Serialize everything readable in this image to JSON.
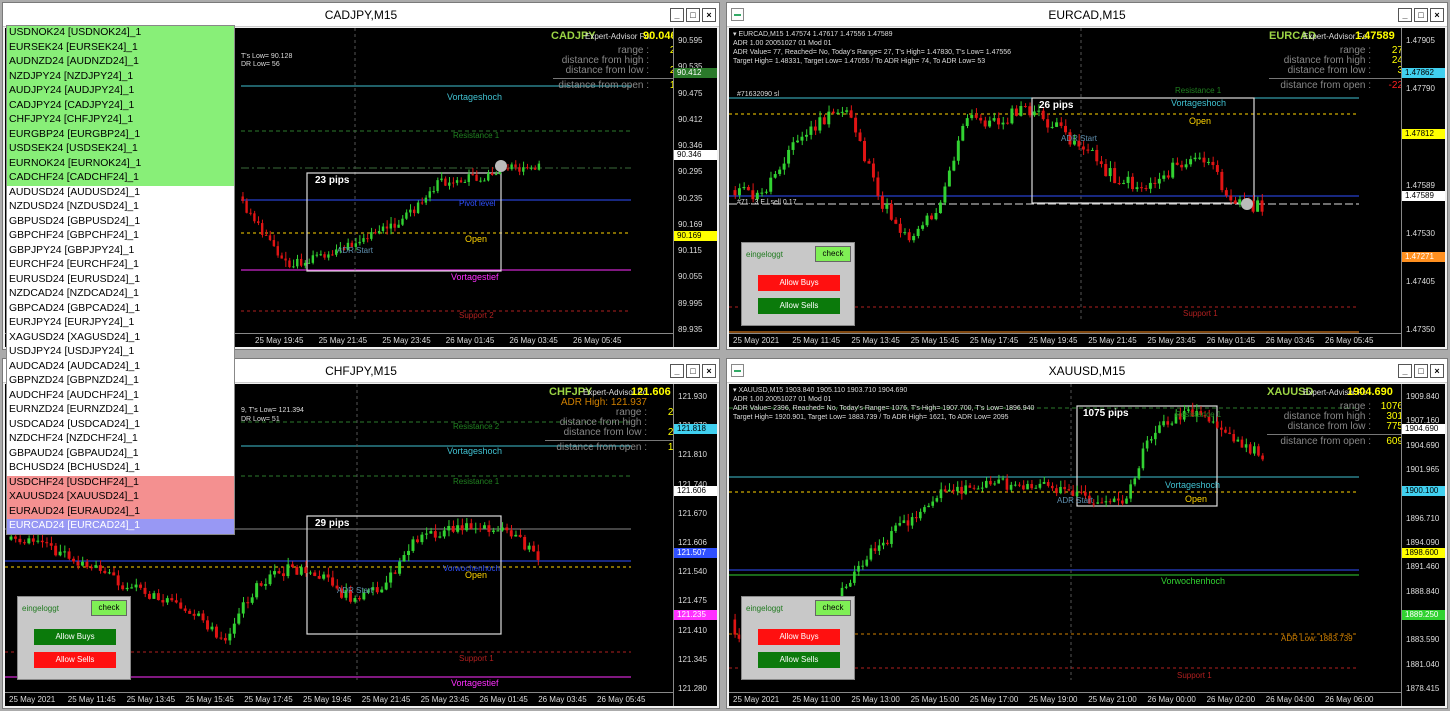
{
  "colors": {
    "bull": "#32d232",
    "bear": "#e01414",
    "green_list": "#88ef78",
    "red_list": "#f49090",
    "blue_list": "#9898f4"
  },
  "windows": [
    {
      "title": "CADJPY,M15",
      "symbol": "CADJPY",
      "ea_label": "Expert-Advisor For",
      "price": "90.046",
      "stats": [
        {
          "label": "range :",
          "value": "23"
        },
        {
          "label": "distance from high :",
          "value": "1"
        },
        {
          "label": "distance from low :",
          "value": "22"
        }
      ],
      "open_label": "distance from open :",
      "open_value": "18",
      "info": [
        "T's Low= 90.128",
        "DR Low= 56"
      ],
      "axis": [
        "90.595",
        "90.535",
        "90.475",
        "90.412",
        "90.346",
        "90.295",
        "90.235",
        "90.169",
        "90.115",
        "90.055",
        "89.995",
        "89.935"
      ],
      "tags": [
        {
          "text": "90.412",
          "bg": "#2b7a2b"
        },
        {
          "text": "90.346",
          "bg": "#fff"
        },
        {
          "text": "90.169",
          "bg": "#ff0"
        }
      ],
      "times": [
        "25 May 19:45",
        "25 May 21:45",
        "25 May 23:45",
        "26 May 01:45",
        "26 May 03:45",
        "26 May 05:45"
      ],
      "pips": "23 pips",
      "labels": [
        {
          "t": "Vortageshoch",
          "c": "#40c0d0"
        },
        {
          "t": "Resistance 1",
          "c": "#208020"
        },
        {
          "t": "ADR Start",
          "c": "#6090b0"
        },
        {
          "t": "Open",
          "c": "#ffd400"
        },
        {
          "t": "Vortagestief",
          "c": "#ff30ff"
        },
        {
          "t": "Support 2",
          "c": "#b02020"
        },
        {
          "t": "Pivot level",
          "c": "#3050ff"
        }
      ]
    },
    {
      "title": "EURCAD,M15",
      "symbol": "EURCAD",
      "ea_label": "Expert-Advisor Fo",
      "price": "1.47589",
      "stats": [
        {
          "label": "range :",
          "value": "27"
        },
        {
          "label": "distance from high :",
          "value": "24"
        },
        {
          "label": "distance from low :",
          "value": "3"
        }
      ],
      "open_label": "distance from open :",
      "open_value": "-22",
      "info": [
        "▾ EURCAD,M15  1.47574 1.47617 1.47556 1.47589",
        "ADR 1.00 20051027 01 Mod 01",
        "ADR Value= 77, Reached= No, Today's Range= 27, T's High= 1.47830, T's Low= 1.47556",
        "Target High= 1.48331, Target Low= 1.47055 / To ADR High= 74, To ADR Low= 53"
      ],
      "axis": [
        "1.47905",
        "1.47790",
        "1.47705",
        "1.47589",
        "1.47530",
        "1.47405",
        "1.47350"
      ],
      "tags": [
        {
          "text": "1.47862",
          "bg": "#40d0f0"
        },
        {
          "text": "1.47812",
          "bg": "#ff0"
        },
        {
          "text": "1.47589",
          "bg": "#fff"
        },
        {
          "text": "1.47271",
          "bg": "#ff9020"
        }
      ],
      "times": [
        "25 May 2021",
        "25 May 11:45",
        "25 May 13:45",
        "25 May 15:45",
        "25 May 17:45",
        "25 May 19:45",
        "25 May 21:45",
        "25 May 23:45",
        "26 May 01:45",
        "26 May 03:45",
        "26 May 05:45"
      ],
      "pips": "26 pips",
      "sl_label": "#71632090 sl",
      "sell_label": "#71.. 3 E l sell 0.17",
      "labels": [
        {
          "t": "Vortageshoch",
          "c": "#40c0d0"
        },
        {
          "t": "Resistance 1",
          "c": "#208020"
        },
        {
          "t": "ADR Start",
          "c": "#6090b0"
        },
        {
          "t": "Open",
          "c": "#ffd400"
        },
        {
          "t": "Support 1",
          "c": "#b02020"
        }
      ],
      "panel": {
        "status": "eingeloggt",
        "check": "check",
        "b1": "Allow Buys",
        "b2": "Allow Sells"
      }
    },
    {
      "title": "CHFJPY,M15",
      "symbol": "CHFJPY",
      "ea_label": "Expert-Advisor Fo",
      "price": "121.606",
      "stats": [
        {
          "label": "ADR High: 121.937",
          "value": ""
        },
        {
          "label": "range :",
          "value": "24"
        },
        {
          "label": "distance from high :",
          "value": "3"
        },
        {
          "label": "distance from low :",
          "value": "21"
        }
      ],
      "open_label": "distance from open :",
      "open_value": "10",
      "info": [
        "9, T's Low= 121.394",
        "DR Low= 51"
      ],
      "axis": [
        "121.930",
        "121.870",
        "121.810",
        "121.740",
        "121.670",
        "121.606",
        "121.540",
        "121.475",
        "121.410",
        "121.345",
        "121.280"
      ],
      "tags": [
        {
          "text": "121.818",
          "bg": "#40d0f0"
        },
        {
          "text": "121.606",
          "bg": "#fff"
        },
        {
          "text": "121.507",
          "bg": "#3050ff"
        },
        {
          "text": "121.235",
          "bg": "#ff30ff"
        }
      ],
      "times": [
        "25 May 2021",
        "25 May 11:45",
        "25 May 13:45",
        "25 May 15:45",
        "25 May 17:45",
        "25 May 19:45",
        "25 May 21:45",
        "25 May 23:45",
        "26 May 01:45",
        "26 May 03:45",
        "26 May 05:45"
      ],
      "pips": "29 pips",
      "labels": [
        {
          "t": "Vortageshoch",
          "c": "#40c0d0"
        },
        {
          "t": "Resistance 2",
          "c": "#208020"
        },
        {
          "t": "Resistance 1",
          "c": "#208020"
        },
        {
          "t": "ADR Start",
          "c": "#6090b0"
        },
        {
          "t": "Open",
          "c": "#ffd400"
        },
        {
          "t": "Support 1",
          "c": "#b02020"
        },
        {
          "t": "Vortagestief",
          "c": "#ff30ff"
        },
        {
          "t": "Vorwochenhoch",
          "c": "#3050ff"
        }
      ],
      "panel": {
        "status": "eingeloggt",
        "check": "check",
        "b1": "Allow Buys",
        "b2": "Allow Sells"
      }
    },
    {
      "title": "XAUUSD,M15",
      "symbol": "XAUUSD",
      "ea_label": "Expert-Advisor Fo",
      "price": "1904.690",
      "stats": [
        {
          "label": "range :",
          "value": "1076"
        },
        {
          "label": "distance from high :",
          "value": "301"
        },
        {
          "label": "distance from low :",
          "value": "775"
        }
      ],
      "open_label": "distance from open :",
      "open_value": "609",
      "info": [
        "▾ XAUUSD,M15  1903.840 1905.110 1903.710 1904.690",
        "ADR 1.00 20051027 01 Mod 01",
        "ADR Value= 2396, Reached= No, Today's Range= 1076, T's High= 1907.700, T's Low= 1896.940",
        "Target High= 1920.901, Target Low= 1883.739 / To ADR High= 1621, To ADR Low= 2095"
      ],
      "axis": [
        "1909.840",
        "1907.160",
        "1904.690",
        "1901.965",
        "1899.340",
        "1896.710",
        "1894.090",
        "1891.460",
        "1888.840",
        "1886.215",
        "1883.590",
        "1881.040",
        "1878.415"
      ],
      "tags": [
        {
          "text": "1904.690",
          "bg": "#fff"
        },
        {
          "text": "1900.100",
          "bg": "#40d0f0"
        },
        {
          "text": "1898.600",
          "bg": "#ff0"
        },
        {
          "text": "1889.250",
          "bg": "#32d232"
        }
      ],
      "times": [
        "25 May 2021",
        "25 May 11:00",
        "25 May 13:00",
        "25 May 15:00",
        "25 May 17:00",
        "25 May 19:00",
        "25 May 21:00",
        "26 May 00:00",
        "26 May 02:00",
        "26 May 04:00",
        "26 May 06:00"
      ],
      "pips": "1075 pips",
      "labels": [
        {
          "t": "Vortageshoch",
          "c": "#40c0d0"
        },
        {
          "t": "Resistance 1",
          "c": "#208020"
        },
        {
          "t": "ADR Start",
          "c": "#6090b0"
        },
        {
          "t": "Open",
          "c": "#ffd400"
        },
        {
          "t": "Vorwochenhoch",
          "c": "#32d232"
        },
        {
          "t": "ADR Low: 1883.739",
          "c": "#d08000"
        },
        {
          "t": "Support 1",
          "c": "#b02020"
        }
      ],
      "panel": {
        "status": "eingeloggt",
        "check": "check",
        "b1": "Allow Buys",
        "b2": "Allow Sells"
      }
    }
  ],
  "symbol_list": [
    {
      "t": "USDNOK24 [USDNOK24]_1",
      "g": "green"
    },
    {
      "t": "EURSEK24 [EURSEK24]_1",
      "g": "green"
    },
    {
      "t": "AUDNZD24 [AUDNZD24]_1",
      "g": "green"
    },
    {
      "t": "NZDJPY24 [NZDJPY24]_1",
      "g": "green"
    },
    {
      "t": "AUDJPY24 [AUDJPY24]_1",
      "g": "green"
    },
    {
      "t": "CADJPY24 [CADJPY24]_1",
      "g": "green"
    },
    {
      "t": "CHFJPY24 [CHFJPY24]_1",
      "g": "green"
    },
    {
      "t": "EURGBP24 [EURGBP24]_1",
      "g": "green"
    },
    {
      "t": "USDSEK24 [USDSEK24]_1",
      "g": "green"
    },
    {
      "t": "EURNOK24 [EURNOK24]_1",
      "g": "green"
    },
    {
      "t": "CADCHF24 [CADCHF24]_1",
      "g": "green"
    },
    {
      "t": "AUDUSD24 [AUDUSD24]_1",
      "g": "white"
    },
    {
      "t": "NZDUSD24 [NZDUSD24]_1",
      "g": "white"
    },
    {
      "t": "GBPUSD24 [GBPUSD24]_1",
      "g": "white"
    },
    {
      "t": "GBPCHF24 [GBPCHF24]_1",
      "g": "white"
    },
    {
      "t": "GBPJPY24 [GBPJPY24]_1",
      "g": "white"
    },
    {
      "t": "EURCHF24 [EURCHF24]_1",
      "g": "white"
    },
    {
      "t": "EURUSD24 [EURUSD24]_1",
      "g": "white"
    },
    {
      "t": "NZDCAD24 [NZDCAD24]_1",
      "g": "white"
    },
    {
      "t": "GBPCAD24 [GBPCAD24]_1",
      "g": "white"
    },
    {
      "t": "EURJPY24 [EURJPY24]_1",
      "g": "white"
    },
    {
      "t": "XAGUSD24 [XAGUSD24]_1",
      "g": "white"
    },
    {
      "t": "USDJPY24 [USDJPY24]_1",
      "g": "white"
    },
    {
      "t": "AUDCAD24 [AUDCAD24]_1",
      "g": "white"
    },
    {
      "t": "GBPNZD24 [GBPNZD24]_1",
      "g": "white"
    },
    {
      "t": "AUDCHF24 [AUDCHF24]_1",
      "g": "white"
    },
    {
      "t": "EURNZD24 [EURNZD24]_1",
      "g": "white"
    },
    {
      "t": "USDCAD24 [USDCAD24]_1",
      "g": "white"
    },
    {
      "t": "NZDCHF24 [NZDCHF24]_1",
      "g": "white"
    },
    {
      "t": "GBPAUD24 [GBPAUD24]_1",
      "g": "white"
    },
    {
      "t": "BCHUSD24 [BCHUSD24]_1",
      "g": "white"
    },
    {
      "t": "USDCHF24 [USDCHF24]_1",
      "g": "red"
    },
    {
      "t": "XAUUSD24 [XAUUSD24]_1",
      "g": "red"
    },
    {
      "t": "EURAUD24 [EURAUD24]_1",
      "g": "red"
    },
    {
      "t": "EURCAD24 [EURCAD24]_1",
      "g": "blue"
    }
  ]
}
